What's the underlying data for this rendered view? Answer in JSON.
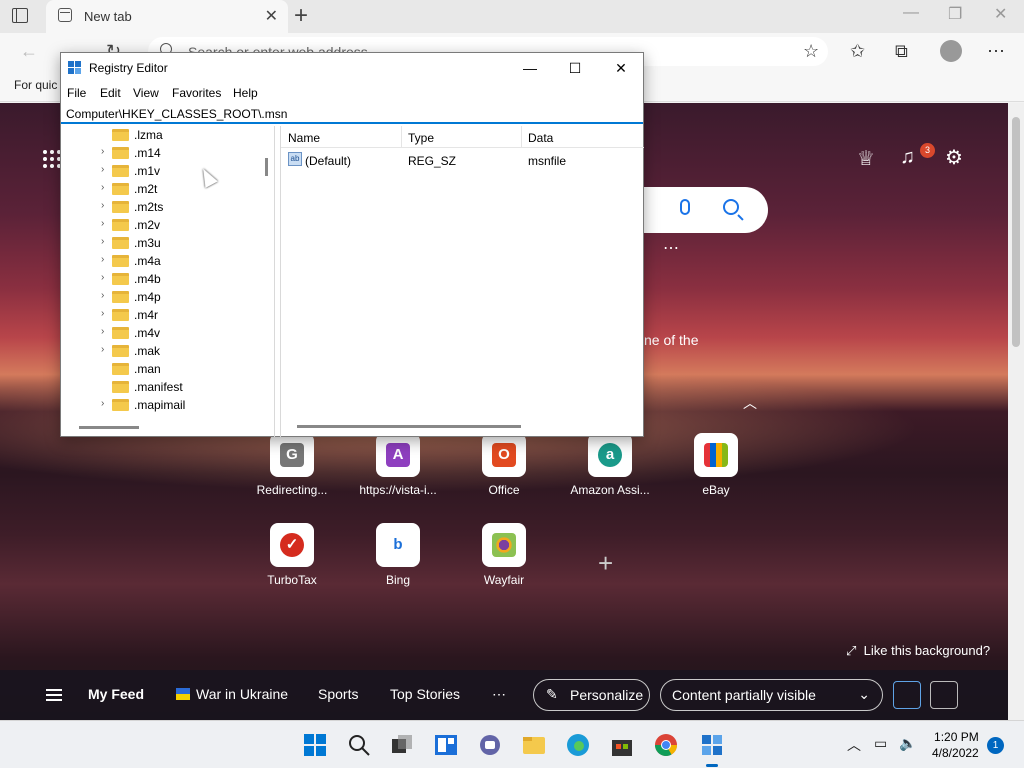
{
  "browser": {
    "tab_title": "New tab",
    "address_placeholder": "Search or enter web address",
    "favorites_label": "For quic"
  },
  "ntp": {
    "partial_text": "ne of the",
    "notification_count": "3",
    "tiles_row1": [
      "Redirecting...",
      "https://vista-i...",
      "Office",
      "Amazon Assi...",
      "eBay"
    ],
    "tiles_row2": [
      "TurboTax",
      "Bing",
      "Wayfair"
    ],
    "like_background": "Like this background?",
    "feed": {
      "my_feed": "My Feed",
      "war": "War in Ukraine",
      "sports": "Sports",
      "top_stories": "Top Stories",
      "personalize": "Personalize",
      "content_visibility": "Content partially visible"
    }
  },
  "regedit": {
    "title": "Registry Editor",
    "menu": [
      "File",
      "Edit",
      "View",
      "Favorites",
      "Help"
    ],
    "address": "Computer\\HKEY_CLASSES_ROOT\\.msn",
    "tree_items": [
      ".lzma",
      ".m14",
      ".m1v",
      ".m2t",
      ".m2ts",
      ".m2v",
      ".m3u",
      ".m4a",
      ".m4b",
      ".m4p",
      ".m4r",
      ".m4v",
      ".mak",
      ".man",
      ".manifest",
      ".mapimail"
    ],
    "columns": {
      "name": "Name",
      "type": "Type",
      "data": "Data"
    },
    "values": [
      {
        "name": "(Default)",
        "type": "REG_SZ",
        "data": "msnfile"
      }
    ]
  },
  "taskbar": {
    "time": "1:20 PM",
    "date": "4/8/2022",
    "notification_count": "1"
  }
}
